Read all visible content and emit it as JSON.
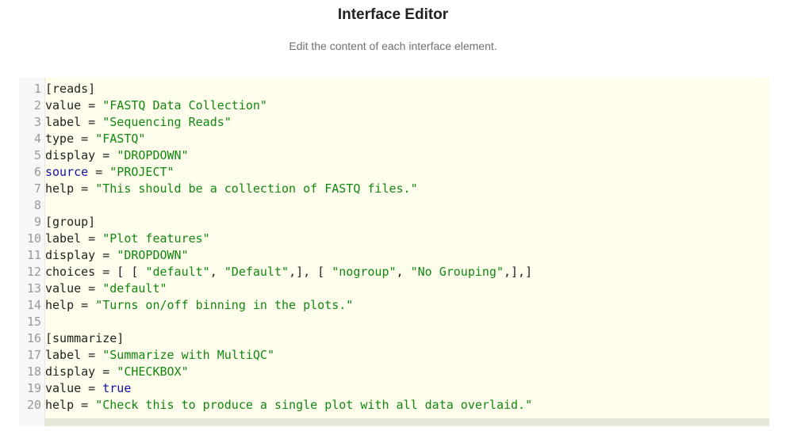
{
  "header": {
    "title": "Interface Editor",
    "subtitle": "Edit the content of each interface element."
  },
  "editor": {
    "lines": [
      {
        "num": "1",
        "parts": [
          {
            "t": "[reads]",
            "c": "plain"
          }
        ]
      },
      {
        "num": "2",
        "parts": [
          {
            "t": "value = ",
            "c": "plain"
          },
          {
            "t": "\"FASTQ Data Collection\"",
            "c": "str"
          }
        ]
      },
      {
        "num": "3",
        "parts": [
          {
            "t": "label = ",
            "c": "plain"
          },
          {
            "t": "\"Sequencing Reads\"",
            "c": "str"
          }
        ]
      },
      {
        "num": "4",
        "parts": [
          {
            "t": "type = ",
            "c": "plain"
          },
          {
            "t": "\"FASTQ\"",
            "c": "str"
          }
        ]
      },
      {
        "num": "5",
        "parts": [
          {
            "t": "display = ",
            "c": "plain"
          },
          {
            "t": "\"DROPDOWN\"",
            "c": "str"
          }
        ]
      },
      {
        "num": "6",
        "parts": [
          {
            "t": "source",
            "c": "kw"
          },
          {
            "t": " = ",
            "c": "plain"
          },
          {
            "t": "\"PROJECT\"",
            "c": "str"
          }
        ]
      },
      {
        "num": "7",
        "parts": [
          {
            "t": "help = ",
            "c": "plain"
          },
          {
            "t": "\"This should be a collection of FASTQ files.\"",
            "c": "str"
          }
        ]
      },
      {
        "num": "8",
        "parts": []
      },
      {
        "num": "9",
        "parts": [
          {
            "t": "[group]",
            "c": "plain"
          }
        ]
      },
      {
        "num": "10",
        "parts": [
          {
            "t": "label = ",
            "c": "plain"
          },
          {
            "t": "\"Plot features\"",
            "c": "str"
          }
        ]
      },
      {
        "num": "11",
        "parts": [
          {
            "t": "display = ",
            "c": "plain"
          },
          {
            "t": "\"DROPDOWN\"",
            "c": "str"
          }
        ]
      },
      {
        "num": "12",
        "parts": [
          {
            "t": "choices = [ [ ",
            "c": "plain"
          },
          {
            "t": "\"default\"",
            "c": "str"
          },
          {
            "t": ", ",
            "c": "plain"
          },
          {
            "t": "\"Default\"",
            "c": "str"
          },
          {
            "t": ",], [ ",
            "c": "plain"
          },
          {
            "t": "\"nogroup\"",
            "c": "str"
          },
          {
            "t": ", ",
            "c": "plain"
          },
          {
            "t": "\"No Grouping\"",
            "c": "str"
          },
          {
            "t": ",],]",
            "c": "plain"
          }
        ]
      },
      {
        "num": "13",
        "parts": [
          {
            "t": "value = ",
            "c": "plain"
          },
          {
            "t": "\"default\"",
            "c": "str"
          }
        ]
      },
      {
        "num": "14",
        "parts": [
          {
            "t": "help = ",
            "c": "plain"
          },
          {
            "t": "\"Turns on/off binning in the plots.\"",
            "c": "str"
          }
        ]
      },
      {
        "num": "15",
        "parts": []
      },
      {
        "num": "16",
        "parts": [
          {
            "t": "[summarize]",
            "c": "plain"
          }
        ]
      },
      {
        "num": "17",
        "parts": [
          {
            "t": "label = ",
            "c": "plain"
          },
          {
            "t": "\"Summarize with MultiQC\"",
            "c": "str"
          }
        ]
      },
      {
        "num": "18",
        "parts": [
          {
            "t": "display = ",
            "c": "plain"
          },
          {
            "t": "\"CHECKBOX\"",
            "c": "str"
          }
        ]
      },
      {
        "num": "19",
        "parts": [
          {
            "t": "value = ",
            "c": "plain"
          },
          {
            "t": "true",
            "c": "kw"
          }
        ]
      },
      {
        "num": "20",
        "parts": [
          {
            "t": "help = ",
            "c": "plain"
          },
          {
            "t": "\"Check this to produce a single plot with all data overlaid.\"",
            "c": "str"
          }
        ]
      }
    ]
  },
  "colors": {
    "editor_background": "#fffdeb",
    "string": "#118811",
    "keyword": "#1111aa",
    "line_number": "#999999"
  }
}
